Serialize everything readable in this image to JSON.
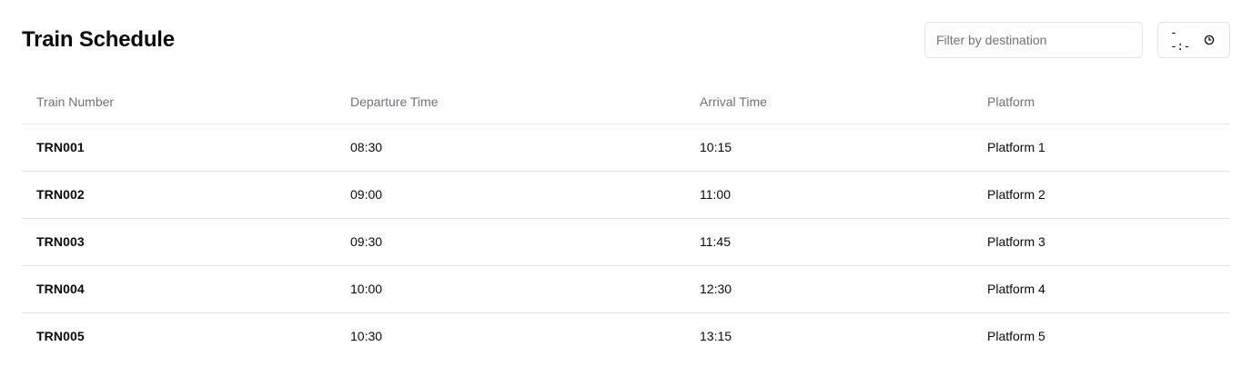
{
  "header": {
    "title": "Train Schedule"
  },
  "filter": {
    "placeholder": "Filter by destination",
    "value": ""
  },
  "time_filter": {
    "display": "--:-",
    "icon": "clock-icon"
  },
  "table": {
    "columns": [
      "Train Number",
      "Departure Time",
      "Arrival Time",
      "Platform"
    ],
    "rows": [
      {
        "train_number": "TRN001",
        "departure": "08:30",
        "arrival": "10:15",
        "platform": "Platform 1"
      },
      {
        "train_number": "TRN002",
        "departure": "09:00",
        "arrival": "11:00",
        "platform": "Platform 2"
      },
      {
        "train_number": "TRN003",
        "departure": "09:30",
        "arrival": "11:45",
        "platform": "Platform 3"
      },
      {
        "train_number": "TRN004",
        "departure": "10:00",
        "arrival": "12:30",
        "platform": "Platform 4"
      },
      {
        "train_number": "TRN005",
        "departure": "10:30",
        "arrival": "13:15",
        "platform": "Platform 5"
      }
    ]
  },
  "colors": {
    "border": "#e4e4e7",
    "muted_text": "#71717a",
    "text": "#0a0a0a"
  }
}
